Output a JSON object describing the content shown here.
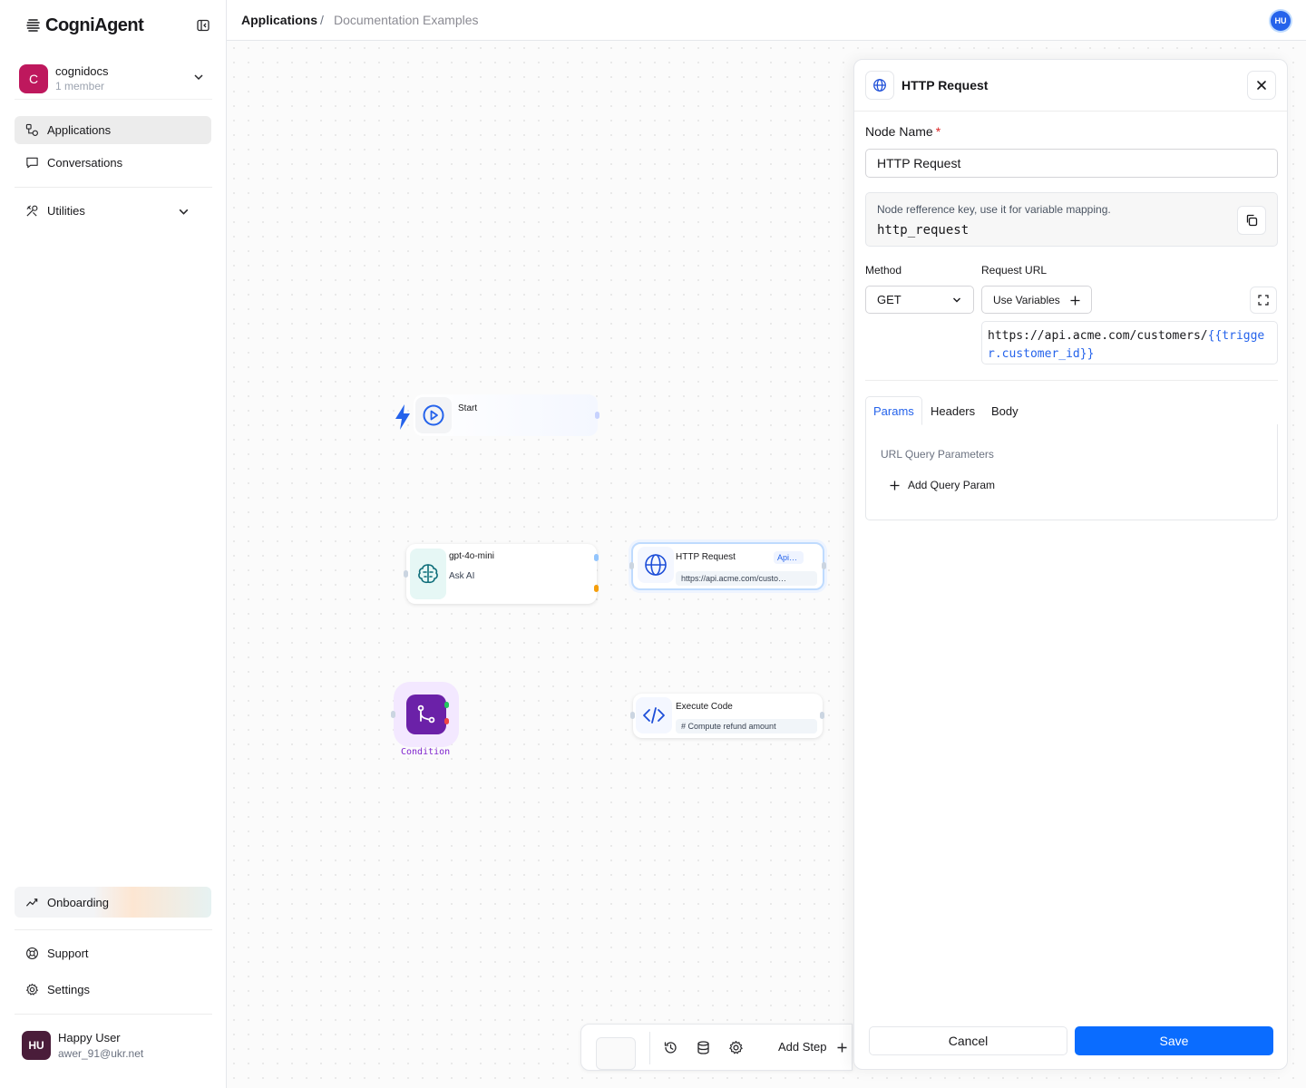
{
  "brand": {
    "name": "CogniAgent"
  },
  "org": {
    "initial": "C",
    "name": "cognidocs",
    "members": "1 member"
  },
  "nav": {
    "applications": "Applications",
    "conversations": "Conversations",
    "utilities": "Utilities",
    "onboarding": "Onboarding",
    "support": "Support",
    "settings": "Settings"
  },
  "user": {
    "initials": "HU",
    "name": "Happy User",
    "email": "awer_91@ukr.net"
  },
  "header": {
    "breadcrumb": [
      "Applications",
      "Documentation Examples"
    ],
    "separator": "/",
    "avatar": "HU"
  },
  "canvas": {
    "start": {
      "title": "Start"
    },
    "llm": {
      "model": "gpt-4o-mini",
      "sub": "Ask AI"
    },
    "http": {
      "title": "HTTP Request",
      "badge": "Api…",
      "url": "https://api.acme.com/custo…"
    },
    "condition": {
      "label": "Condition"
    },
    "code": {
      "title": "Execute Code",
      "snippet": "#  Compute  refund  amount"
    }
  },
  "toolbar": {
    "add_step": "Add Step"
  },
  "panel": {
    "title": "HTTP Request",
    "node_name_label": "Node Name",
    "required_mark": "*",
    "node_name_value": "HTTP Request",
    "ref_desc": "Node refference key, use it for variable mapping.",
    "ref_key": "http_request",
    "method_label": "Method",
    "method_value": "GET",
    "url_label": "Request URL",
    "use_variables": "Use Variables",
    "url_static": "https://api.acme.com/customers/",
    "url_variable": "{{trigger.customer_id}}",
    "tabs": [
      "Params",
      "Headers",
      "Body"
    ],
    "active_tab": "Params",
    "params_title": "URL Query Parameters",
    "add_param": "Add Query Param",
    "cancel": "Cancel",
    "save": "Save"
  },
  "colors": {
    "primary": "#0a6cff",
    "org_avatar": "#be185d",
    "user_avatar": "#4a1d3a",
    "condition": "#6b21a8",
    "required": "#dc2626"
  }
}
